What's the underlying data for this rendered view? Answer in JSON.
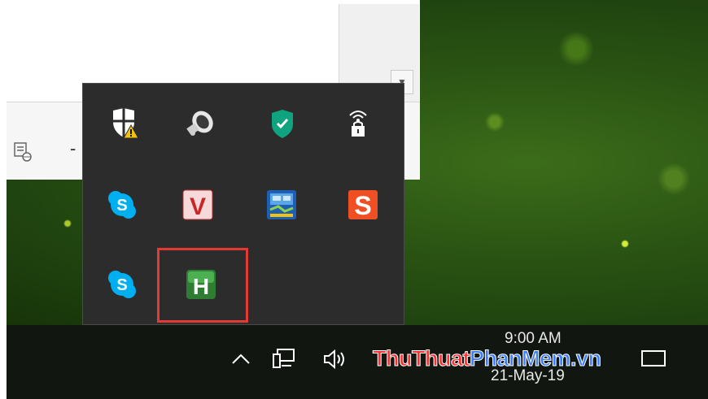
{
  "overflow_tray": {
    "icons": [
      {
        "name": "windows-security-warning-icon",
        "tooltip": ""
      },
      {
        "name": "speaker-icon",
        "tooltip": ""
      },
      {
        "name": "kaspersky-icon",
        "tooltip": ""
      },
      {
        "name": "vpn-lock-icon",
        "tooltip": ""
      },
      {
        "name": "skype-icon",
        "tooltip": ""
      },
      {
        "name": "v-app-icon",
        "tooltip": ""
      },
      {
        "name": "network-tool-icon",
        "tooltip": ""
      },
      {
        "name": "s-app-icon",
        "tooltip": ""
      },
      {
        "name": "skype-icon",
        "tooltip": ""
      },
      {
        "name": "h-app-icon",
        "tooltip": ""
      }
    ],
    "highlight_color": "#e53935"
  },
  "taskbar": {
    "chevron": "^",
    "time": "9:00 AM",
    "date": "21-May-19"
  },
  "watermark": {
    "part1": "Thu",
    "part2": "Thuat",
    "part3": "Phan",
    "part4": "Mem",
    "part5": ".vn"
  },
  "window": {
    "minimize_label": "-"
  }
}
